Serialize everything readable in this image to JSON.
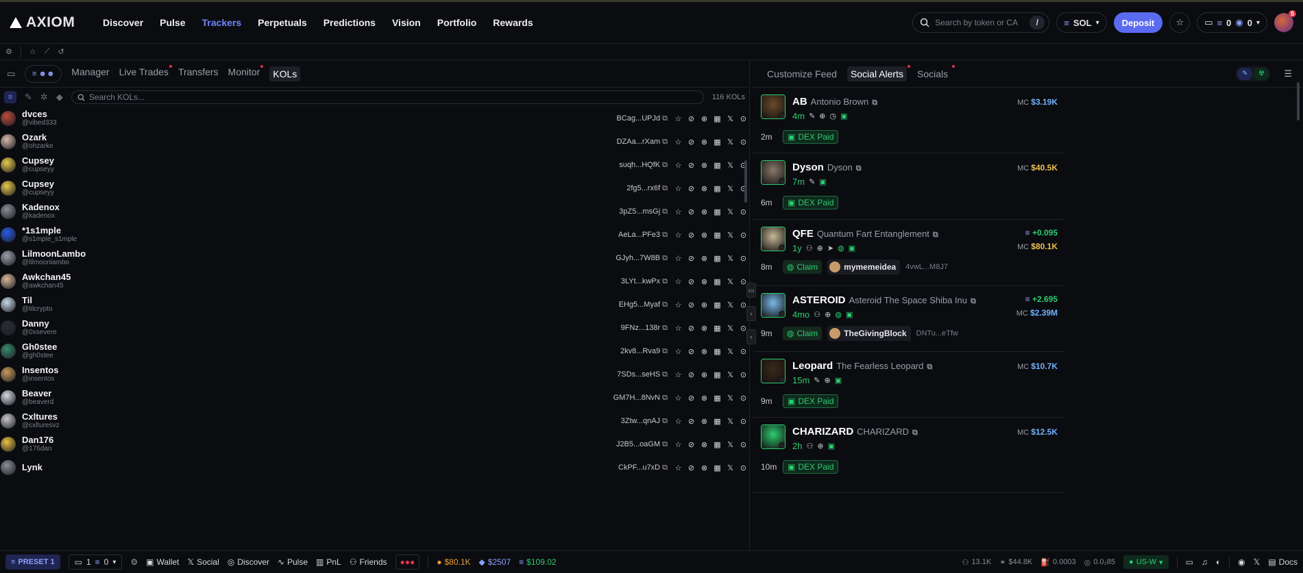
{
  "app": {
    "name": "AXIOM"
  },
  "nav": [
    "Discover",
    "Pulse",
    "Trackers",
    "Perpetuals",
    "Predictions",
    "Vision",
    "Portfolio",
    "Rewards"
  ],
  "nav_active": "Trackers",
  "search_top": {
    "placeholder": "Search by token or CA",
    "shortcut": "/"
  },
  "network": "SOL",
  "deposit_label": "Deposit",
  "wallet": {
    "sol": "0",
    "other": "0"
  },
  "notif_count": "5",
  "left_tabs": [
    "Manager",
    "Live Trades",
    "Transfers",
    "Monitor",
    "KOLs"
  ],
  "left_tabs_dot": [
    false,
    true,
    false,
    true,
    false
  ],
  "left_active": "KOLs",
  "kol_search": {
    "placeholder": "Search KOLs..."
  },
  "kol_count": "116 KOLs",
  "kols": [
    {
      "name": "dvces",
      "handle": "@vibed333",
      "addr": "BCag...UPJd",
      "color": "#b94a3a"
    },
    {
      "name": "Ozark",
      "handle": "@ohzarke",
      "addr": "DZAa...rXam",
      "color": "#d8b8a8"
    },
    {
      "name": "Cupsey",
      "handle": "@cupseyy",
      "addr": "suqh...HQfK",
      "color": "#e8c84a"
    },
    {
      "name": "Cupsey",
      "handle": "@cupseyy",
      "addr": "2fg5...rx6f",
      "color": "#e8c84a"
    },
    {
      "name": "Kadenox",
      "handle": "@kadenox",
      "addr": "3pZ5...msGj",
      "color": "#8a8d96"
    },
    {
      "name": "*1s1mple",
      "handle": "@s1mple_s1mple",
      "addr": "AeLa...PFe3",
      "color": "#2a5be8"
    },
    {
      "name": "LilmoonLambo",
      "handle": "@lilmoonlambo",
      "addr": "GJyh...7W8B",
      "color": "#9aa0a8"
    },
    {
      "name": "Awkchan45",
      "handle": "@awkchan45",
      "addr": "3LYt...kwPx",
      "color": "#d8b898"
    },
    {
      "name": "Til",
      "handle": "@tilcrypto",
      "addr": "EHg5...Myaf",
      "color": "#c8d8e8"
    },
    {
      "name": "Danny",
      "handle": "@0xsevere",
      "addr": "9FNz...138r",
      "color": "#2a2d36"
    },
    {
      "name": "Gh0stee",
      "handle": "@gh0stee",
      "addr": "2kv8...Rva9",
      "color": "#3a8a6a"
    },
    {
      "name": "Insentos",
      "handle": "@insentos",
      "addr": "7SDs...seHS",
      "color": "#c8985a"
    },
    {
      "name": "Beaver",
      "handle": "@beaverd",
      "addr": "GM7H...8NvN",
      "color": "#d8d8e0"
    },
    {
      "name": "Cxltures",
      "handle": "@cxlturesvz",
      "addr": "3Ztw...qnAJ",
      "color": "#c8c8c8"
    },
    {
      "name": "Dan176",
      "handle": "@176dan",
      "addr": "J2B5...oaGM",
      "color": "#e8c040"
    },
    {
      "name": "Lynk",
      "handle": "",
      "addr": "CkPF...u7xD",
      "color": "#8a8d96"
    }
  ],
  "right_tabs": [
    "Customize Feed",
    "Social Alerts",
    "Socials"
  ],
  "right_tabs_dot": [
    false,
    true,
    true
  ],
  "right_active": "Social Alerts",
  "mc_label": "MC",
  "alerts": [
    {
      "sym": "AB",
      "name": "Antonio Brown",
      "age": "4m",
      "mc": "$3.19K",
      "mc_color": "blue",
      "delta": "",
      "time": "2m",
      "kind": "dex",
      "label": "DEX Paid",
      "user": "",
      "addr": "",
      "icons": [
        "pen",
        "globe",
        "clock",
        "shield"
      ],
      "img": "#6b4a2a"
    },
    {
      "sym": "Dyson",
      "name": "Dyson",
      "age": "7m",
      "mc": "$40.5K",
      "mc_color": "yellow",
      "delta": "",
      "time": "6m",
      "kind": "dex",
      "label": "DEX Paid",
      "user": "",
      "addr": "",
      "icons": [
        "pen",
        "shield"
      ],
      "img": "#8a7a6a"
    },
    {
      "sym": "QFE",
      "name": "Quantum Fart Entanglement",
      "age": "1y",
      "mc": "$80.1K",
      "mc_color": "yellow",
      "delta": "+0.095",
      "time": "8m",
      "kind": "claim",
      "label": "Claim",
      "user": "mymemeidea",
      "addr": "4vwL...M8J7",
      "icons": [
        "user",
        "globe",
        "send",
        "bag",
        "shield"
      ],
      "img": "#c8b898"
    },
    {
      "sym": "ASTEROID",
      "name": "Asteroid The Space Shiba Inu",
      "age": "4mo",
      "mc": "$2.39M",
      "mc_color": "green",
      "delta": "+2.695",
      "time": "9m",
      "kind": "claim",
      "label": "Claim",
      "user": "TheGivingBlock",
      "addr": "DNTu...eTfw",
      "icons": [
        "user",
        "globe",
        "bag",
        "shield"
      ],
      "img": "#7ab8e8"
    },
    {
      "sym": "Leopard",
      "name": "The Fearless Leopard",
      "age": "15m",
      "mc": "$10.7K",
      "mc_color": "blue",
      "delta": "",
      "time": "9m",
      "kind": "dex",
      "label": "DEX Paid",
      "user": "",
      "addr": "",
      "icons": [
        "pen",
        "globe",
        "shield"
      ],
      "img": "#3a2a1a"
    },
    {
      "sym": "CHARIZARD",
      "name": "CHARIZARD",
      "age": "2h",
      "mc": "$12.5K",
      "mc_color": "blue",
      "delta": "",
      "time": "10m",
      "kind": "dex",
      "label": "DEX Paid",
      "user": "",
      "addr": "",
      "icons": [
        "user",
        "globe",
        "shield"
      ],
      "img": "#2ecc71"
    }
  ],
  "bottom": {
    "preset": "PRESET 1",
    "wallets": "1",
    "sol": "0",
    "wallet": "Wallet",
    "social": "Social",
    "discover": "Discover",
    "pulse": "Pulse",
    "pnl": "PnL",
    "friends": "Friends",
    "btc": "$80.1K",
    "eth": "$2507",
    "sol_price": "$109.02",
    "users": "13.1K",
    "vol": "$44.8K",
    "fee": "0.0003",
    "gas": "0.0₂85",
    "region": "US-W",
    "docs": "Docs"
  },
  "colors": {
    "accent": "#6f86ff",
    "green": "#2ecc71",
    "yellow": "#f0c050",
    "blue": "#6fb3ff"
  }
}
